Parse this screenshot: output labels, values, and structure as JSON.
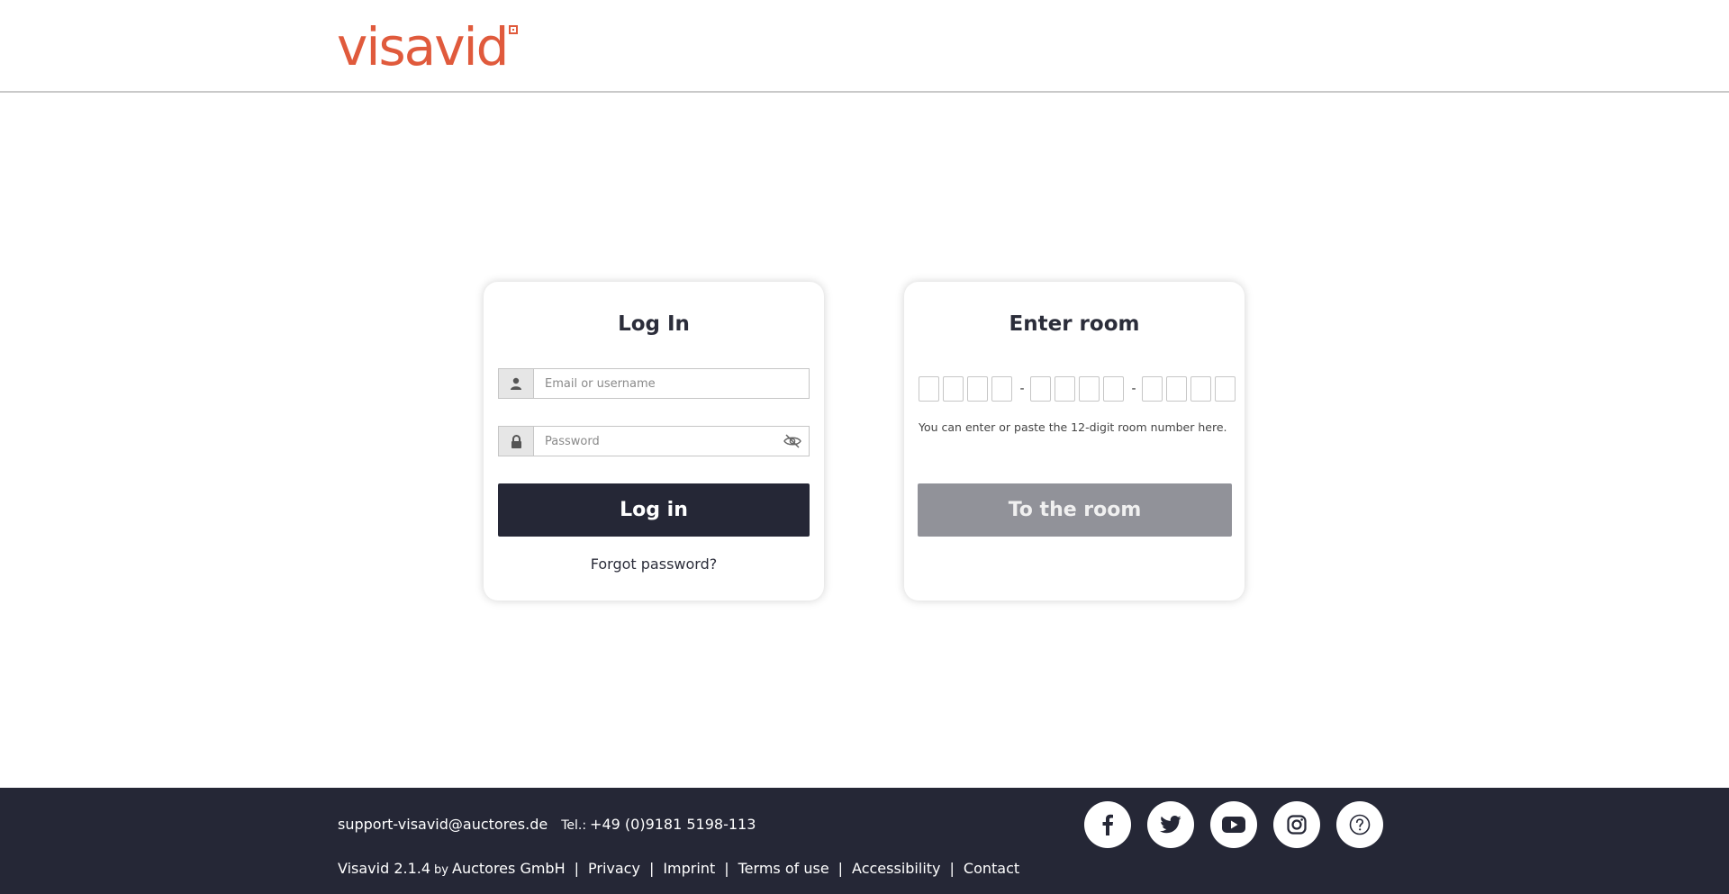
{
  "brand": {
    "logo_text": "visavid",
    "accent": "#e05a3c"
  },
  "login": {
    "title": "Log In",
    "username_placeholder": "Email or username",
    "password_placeholder": "Password",
    "submit_label": "Log in",
    "forgot_label": "Forgot password?"
  },
  "room": {
    "title": "Enter room",
    "digit_groups": 3,
    "digits_per_group": 4,
    "separator": "-",
    "hint": "You can enter or paste the 12-digit room number here.",
    "submit_label": "To the room"
  },
  "footer": {
    "email": "support-visavid@auctores.de",
    "tel_label": "Tel.:",
    "tel_number": "+49 (0)9181 5198-113",
    "version": "Visavid 2.1.4",
    "by": "by",
    "company": "Auctores GmbH",
    "links": [
      "Privacy",
      "Imprint",
      "Terms of use",
      "Accessibility",
      "Contact"
    ],
    "socials": [
      "facebook-icon",
      "twitter-icon",
      "youtube-icon",
      "instagram-icon",
      "help-icon"
    ]
  },
  "colors": {
    "dark": "#252736",
    "disabled": "#919299"
  }
}
